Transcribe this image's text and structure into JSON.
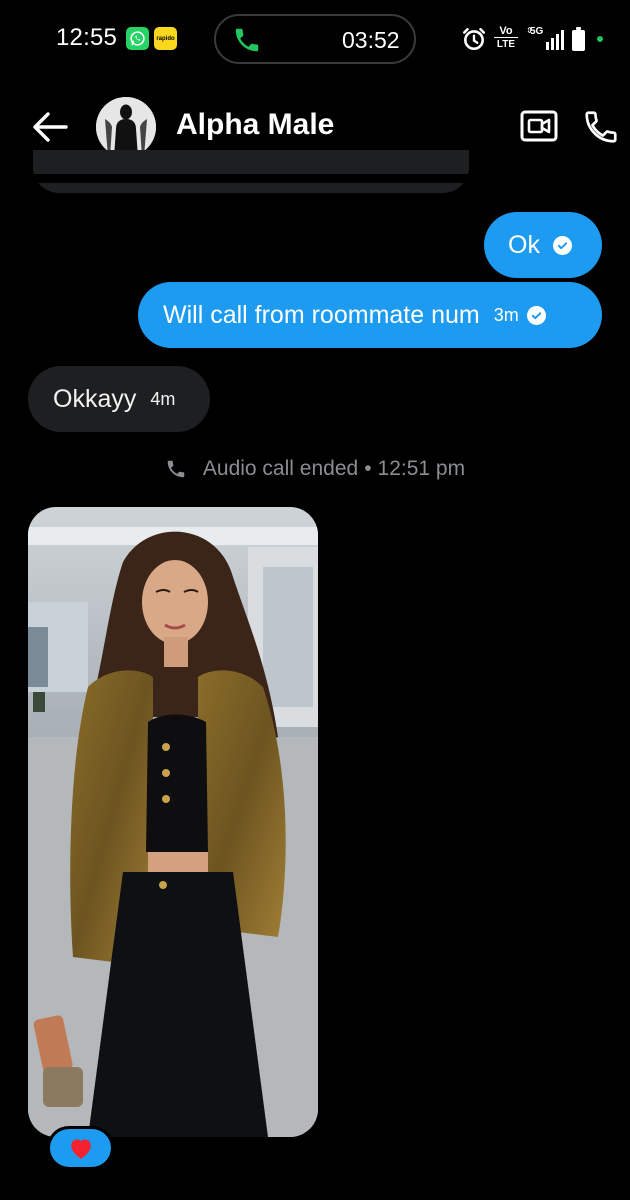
{
  "status_bar": {
    "time": "12:55",
    "call_timer": "03:52",
    "icons": [
      "whatsapp-icon",
      "rapido-icon",
      "phone-icon",
      "alarm-icon",
      "volte-icon",
      "5g-signal-icon",
      "battery-icon",
      "dot-icon"
    ],
    "rapido_label": "rapido",
    "volte_label_top": "Vo",
    "volte_label_bottom": "LTE",
    "network_label": "5G"
  },
  "header": {
    "contact_name": "Alpha Male",
    "icons": [
      "back-arrow-icon",
      "video-call-icon",
      "phone-call-icon"
    ]
  },
  "messages": [
    {
      "direction": "outgoing",
      "text": "Ok",
      "time": "",
      "status": "read"
    },
    {
      "direction": "outgoing",
      "text": "Will call from roommate num",
      "time": "3m",
      "status": "read"
    },
    {
      "direction": "incoming",
      "text": "Okkayy",
      "time": "4m"
    }
  ],
  "system_message": {
    "icon": "phone-icon",
    "text": "Audio call ended",
    "separator": "•",
    "time": "12:51 pm"
  },
  "photo_message": {
    "reaction": "heart-icon"
  },
  "colors": {
    "background": "#000000",
    "outgoing_bubble": "#1d9bf0",
    "incoming_bubble": "#1e1f21",
    "muted_text": "#8a8d91",
    "reaction_heart": "#f4212e"
  }
}
